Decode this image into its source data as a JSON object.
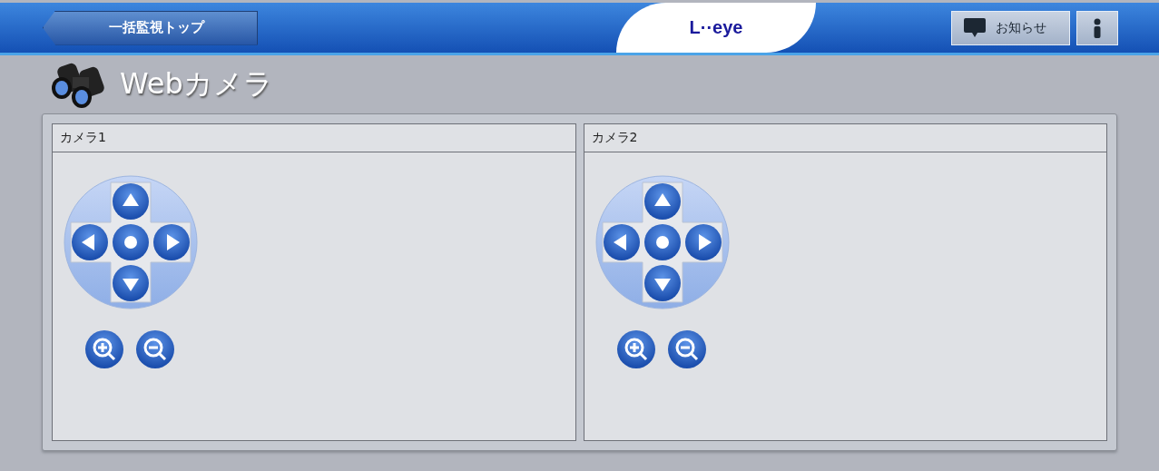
{
  "header": {
    "back_button": "一括監視トップ",
    "logo": "L··eye",
    "notice_button": "お知らせ"
  },
  "page_title": "Webカメラ",
  "cameras": [
    {
      "label": "カメラ1"
    },
    {
      "label": "カメラ2"
    }
  ]
}
